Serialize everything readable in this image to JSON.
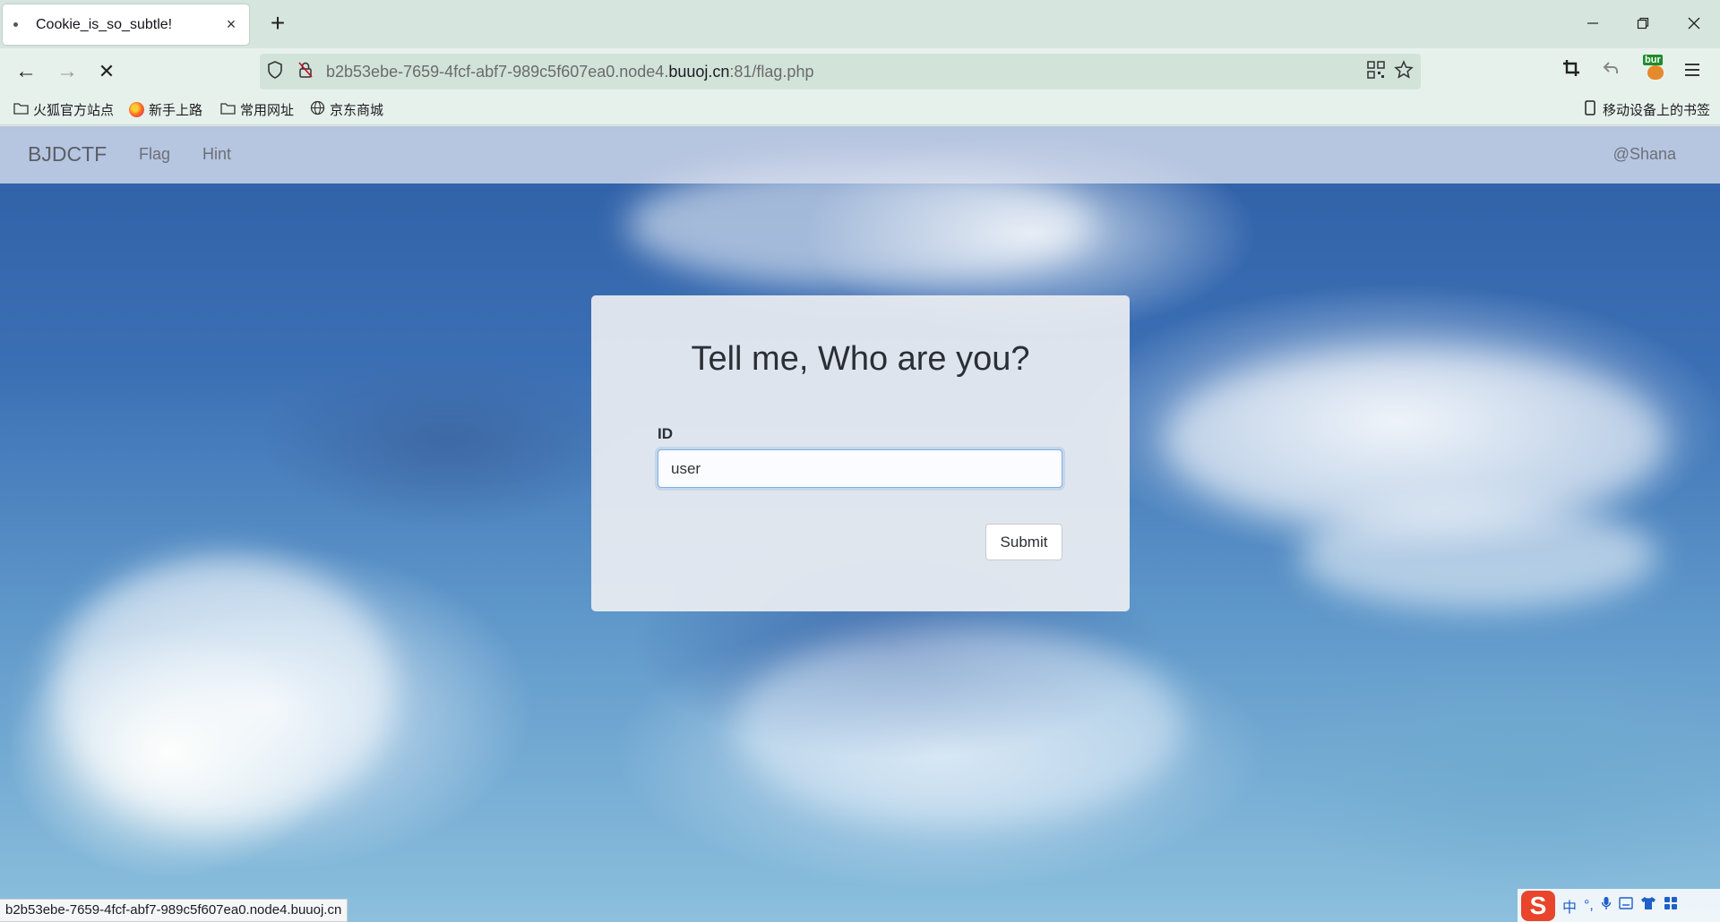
{
  "tab": {
    "title": "Cookie_is_so_subtle!",
    "close_glyph": "×",
    "new_tab_glyph": "+"
  },
  "window_controls": {
    "minimize": "—",
    "restore": "❐",
    "close": "✕"
  },
  "toolbar": {
    "back": "←",
    "forward": "→",
    "stop": "✕"
  },
  "url": {
    "prefix": "b2b53ebe-7659-4fcf-abf7-989c5f607ea0.node4.",
    "domain": "buuoj.cn",
    "suffix": ":81/flag.php"
  },
  "extension": {
    "label": "bur"
  },
  "bookmarks": {
    "items": [
      {
        "label": "火狐官方站点",
        "icon": "folder-icon"
      },
      {
        "label": "新手上路",
        "icon": "firefox-icon"
      },
      {
        "label": "常用网址",
        "icon": "folder-icon"
      },
      {
        "label": "京东商城",
        "icon": "globe-icon"
      }
    ],
    "mobile": "移动设备上的书签"
  },
  "site": {
    "brand": "BJDCTF",
    "nav": [
      "Flag",
      "Hint"
    ],
    "user": "@Shana"
  },
  "form": {
    "title": "Tell me, Who are you?",
    "id_label": "ID",
    "id_value": "user",
    "submit_label": "Submit"
  },
  "status_bar": {
    "text": "b2b53ebe-7659-4fcf-abf7-989c5f607ea0.node4.buuoj.cn"
  },
  "ime": {
    "logo": "S",
    "mode": "中"
  }
}
